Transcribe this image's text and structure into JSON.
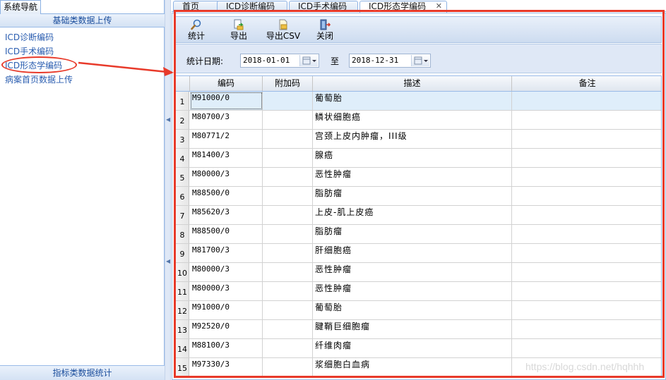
{
  "nav": {
    "title": "系统导航",
    "group_header": "基础类数据上传",
    "items": [
      "ICD诊断编码",
      "ICD手术编码",
      "ICD形态学编码",
      "病案首页数据上传"
    ],
    "footer": "指标类数据统计"
  },
  "tabs": [
    {
      "label": "首页"
    },
    {
      "label": "ICD诊断编码"
    },
    {
      "label": "ICD手术编码"
    },
    {
      "label": "ICD形态学编码",
      "close": "✕"
    }
  ],
  "toolbar": {
    "stat_label": "统计",
    "export_label": "导出",
    "export_csv_label": "导出CSV",
    "close_label": "关闭"
  },
  "filter": {
    "date_label": "统计日期:",
    "start_date": "2018-01-01",
    "to_label": "至",
    "end_date": "2018-12-31"
  },
  "grid": {
    "columns": [
      "编码",
      "附加码",
      "描述",
      "备注"
    ],
    "rows": [
      {
        "n": "1",
        "code": "M91000/0",
        "extra": "",
        "desc": "葡萄胎",
        "note": ""
      },
      {
        "n": "2",
        "code": "M80700/3",
        "extra": "",
        "desc": "鳞状细胞癌",
        "note": ""
      },
      {
        "n": "3",
        "code": "M80771/2",
        "extra": "",
        "desc": "宫颈上皮内肿瘤，III级",
        "note": ""
      },
      {
        "n": "4",
        "code": "M81400/3",
        "extra": "",
        "desc": "腺癌",
        "note": ""
      },
      {
        "n": "5",
        "code": "M80000/3",
        "extra": "",
        "desc": "恶性肿瘤",
        "note": ""
      },
      {
        "n": "6",
        "code": "M88500/0",
        "extra": "",
        "desc": "脂肪瘤",
        "note": ""
      },
      {
        "n": "7",
        "code": "M85620/3",
        "extra": "",
        "desc": "上皮-肌上皮癌",
        "note": ""
      },
      {
        "n": "8",
        "code": "M88500/0",
        "extra": "",
        "desc": "脂肪瘤",
        "note": ""
      },
      {
        "n": "9",
        "code": "M81700/3",
        "extra": "",
        "desc": "肝细胞癌",
        "note": ""
      },
      {
        "n": "10",
        "code": "M80000/3",
        "extra": "",
        "desc": "恶性肿瘤",
        "note": ""
      },
      {
        "n": "11",
        "code": "M80000/3",
        "extra": "",
        "desc": "恶性肿瘤",
        "note": ""
      },
      {
        "n": "12",
        "code": "M91000/0",
        "extra": "",
        "desc": "葡萄胎",
        "note": ""
      },
      {
        "n": "13",
        "code": "M92520/0",
        "extra": "",
        "desc": "腱鞘巨细胞瘤",
        "note": ""
      },
      {
        "n": "14",
        "code": "M88100/3",
        "extra": "",
        "desc": "纤维肉瘤",
        "note": ""
      },
      {
        "n": "15",
        "code": "M97330/3",
        "extra": "",
        "desc": "浆细胞白血病",
        "note": ""
      }
    ]
  },
  "icons": {
    "stat": "magnifier-icon",
    "export": "export-icon",
    "export_csv": "export-csv-icon",
    "close": "exit-door-icon",
    "date": "calendar-icon"
  },
  "watermark": "https://blog.csdn.net/hqhhh",
  "colors": {
    "annotation": "#e83a2a",
    "selected_row": "#dfeefa",
    "nav_link": "#2a5db0"
  }
}
